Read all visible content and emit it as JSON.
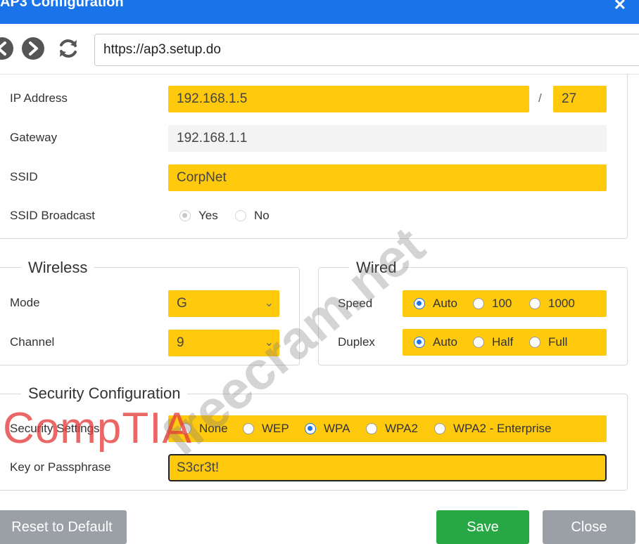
{
  "window": {
    "title": "AP3 Configuration",
    "close_glyph": "✕"
  },
  "browser": {
    "url": "https://ap3.setup.do",
    "icons": [
      "back-arrow-icon",
      "forward-arrow-icon",
      "refresh-icon"
    ]
  },
  "network": {
    "ip_label": "IP Address",
    "ip_value": "192.168.1.5",
    "slash": "/",
    "prefix": "27",
    "gateway_label": "Gateway",
    "gateway_value": "192.168.1.1",
    "ssid_label": "SSID",
    "ssid_value": "CorpNet",
    "broadcast_label": "SSID Broadcast",
    "broadcast_yes": "Yes",
    "broadcast_no": "No"
  },
  "wireless": {
    "legend": "Wireless",
    "mode_label": "Mode",
    "mode_value": "G",
    "channel_label": "Channel",
    "channel_value": "9"
  },
  "wired": {
    "legend": "Wired",
    "speed_label": "Speed",
    "speed_options": [
      "Auto",
      "100",
      "1000"
    ],
    "duplex_label": "Duplex",
    "duplex_options": [
      "Auto",
      "Half",
      "Full"
    ]
  },
  "security": {
    "legend": "Security Configuration",
    "settings_label": "Security Settings",
    "options": [
      "None",
      "WEP",
      "WPA",
      "WPA2",
      "WPA2 - Enterprise"
    ],
    "key_label": "Key or Passphrase",
    "key_value": "S3cr3t!"
  },
  "buttons": {
    "reset": "Reset to Default",
    "save": "Save",
    "close": "Close"
  },
  "watermarks": {
    "freecram": "freecram.net",
    "comptia": "CompTIA"
  },
  "colors": {
    "title_bar": "#1a73e8",
    "field_highlight": "#ffc90e",
    "save": "#28a745",
    "secondary": "#9aa0a6"
  }
}
